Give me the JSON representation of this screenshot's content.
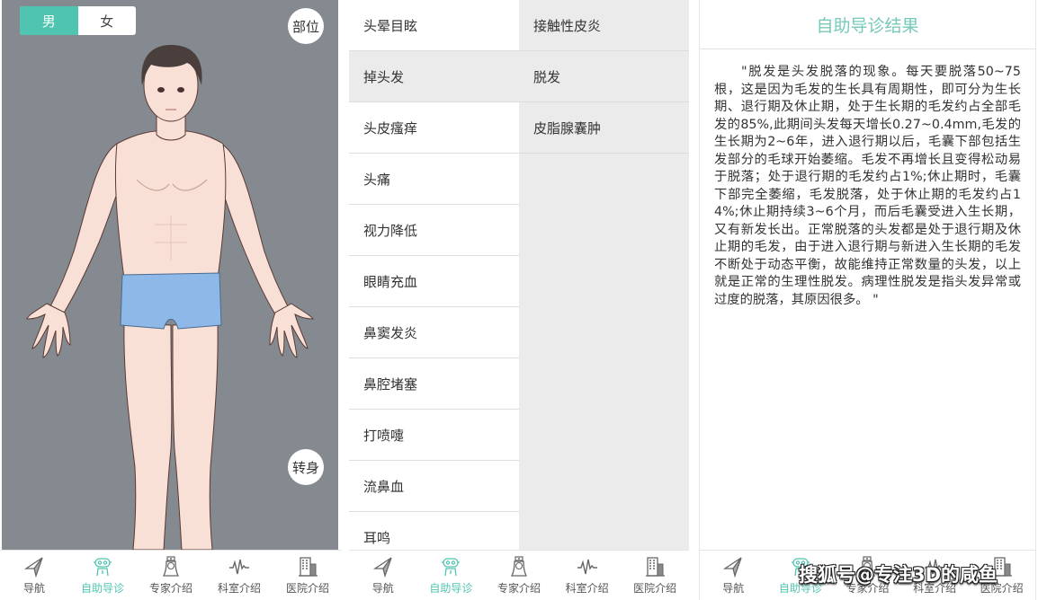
{
  "colors": {
    "accent": "#4fc4b0",
    "body_bg": "#858990",
    "title_green": "#76c9b8",
    "shorts_blue": "#8db8e8"
  },
  "screen1": {
    "gender": {
      "options": [
        "男",
        "女"
      ],
      "selected": "男"
    },
    "part_button": "部位",
    "turn_button": "转身",
    "figure_icon": "human-body-front-male"
  },
  "screen2": {
    "symptoms_left": [
      "头晕目眩",
      "掉头发",
      "头皮瘙痒",
      "头痛",
      "视力降低",
      "眼睛充血",
      "鼻窦发炎",
      "鼻腔堵塞",
      "打喷嚏",
      "流鼻血",
      "耳鸣"
    ],
    "symptoms_left_selected": "掉头发",
    "symptoms_right": [
      "接触性皮炎",
      "脱发",
      "皮脂腺囊肿"
    ],
    "symptoms_right_selected": "脱发"
  },
  "screen3": {
    "title": "自助导诊结果",
    "result_text": "\"脱发是头发脱落的现象。每天要脱落50~75根，这是因为毛发的生长具有周期性，即可分为生长期、退行期及休止期，处于生长期的毛发约占全部毛发的85%,此期间头发每天增长0.27~0.4mm,毛发的生长期为2~6年，进入退行期以后，毛囊下部包括生发部分的毛球开始萎缩。毛发不再增长且变得松动易于脱落；处于退行期的毛发约占1%;休止期时，毛囊下部完全萎缩，毛发脱落，处于休止期的毛发约占14%;休止期持续3~6个月，而后毛囊受进入生长期，又有新发长出。正常脱落的头发都是处于退行期及休止期的毛发，由于进入退行期与新进入生长期的毛发不断处于动态平衡，故能维持正常数量的头发，以上就是正常的生理性脱发。病理性脱发是指头发异常或过度的脱落，其原因很多。 \"",
    "watermark": "搜狐号@专注3D的咸鱼"
  },
  "nav": {
    "items": [
      {
        "label": "导航",
        "icon": "navigation-arrow-icon"
      },
      {
        "label": "自助导诊",
        "icon": "robot-icon"
      },
      {
        "label": "专家介绍",
        "icon": "nurse-icon"
      },
      {
        "label": "科室介绍",
        "icon": "heartbeat-icon"
      },
      {
        "label": "医院介绍",
        "icon": "hospital-building-icon"
      }
    ],
    "active": "自助导诊"
  }
}
